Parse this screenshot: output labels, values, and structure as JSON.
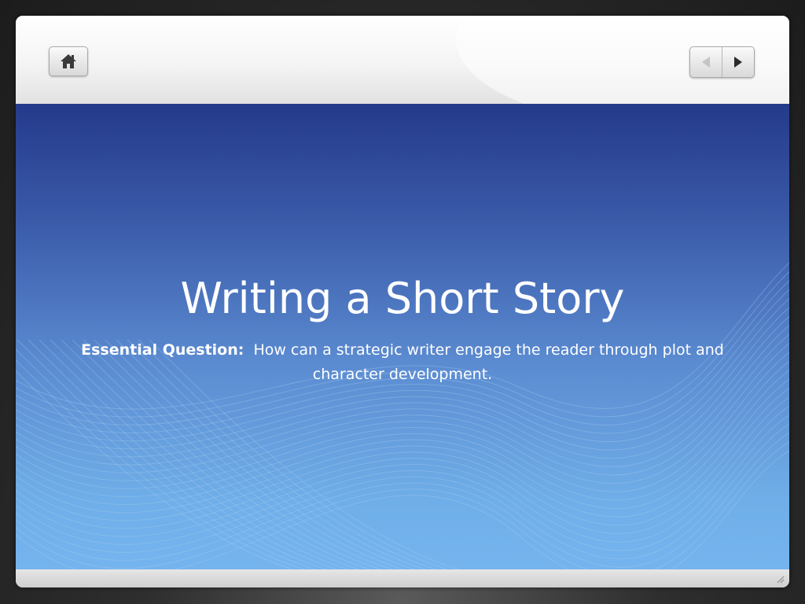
{
  "toolbar": {
    "home_icon": "home-icon",
    "prev_icon": "triangle-left-icon",
    "next_icon": "triangle-right-icon"
  },
  "slide": {
    "title": "Writing a Short Story",
    "essential_label": "Essential Question:",
    "essential_text": "How can a strategic writer engage the reader through plot and character development."
  },
  "colors": {
    "slide_top": "#243a8a",
    "slide_bottom": "#75b4ee",
    "frame": "#f2f2f2",
    "background": "#1c1c1c"
  }
}
